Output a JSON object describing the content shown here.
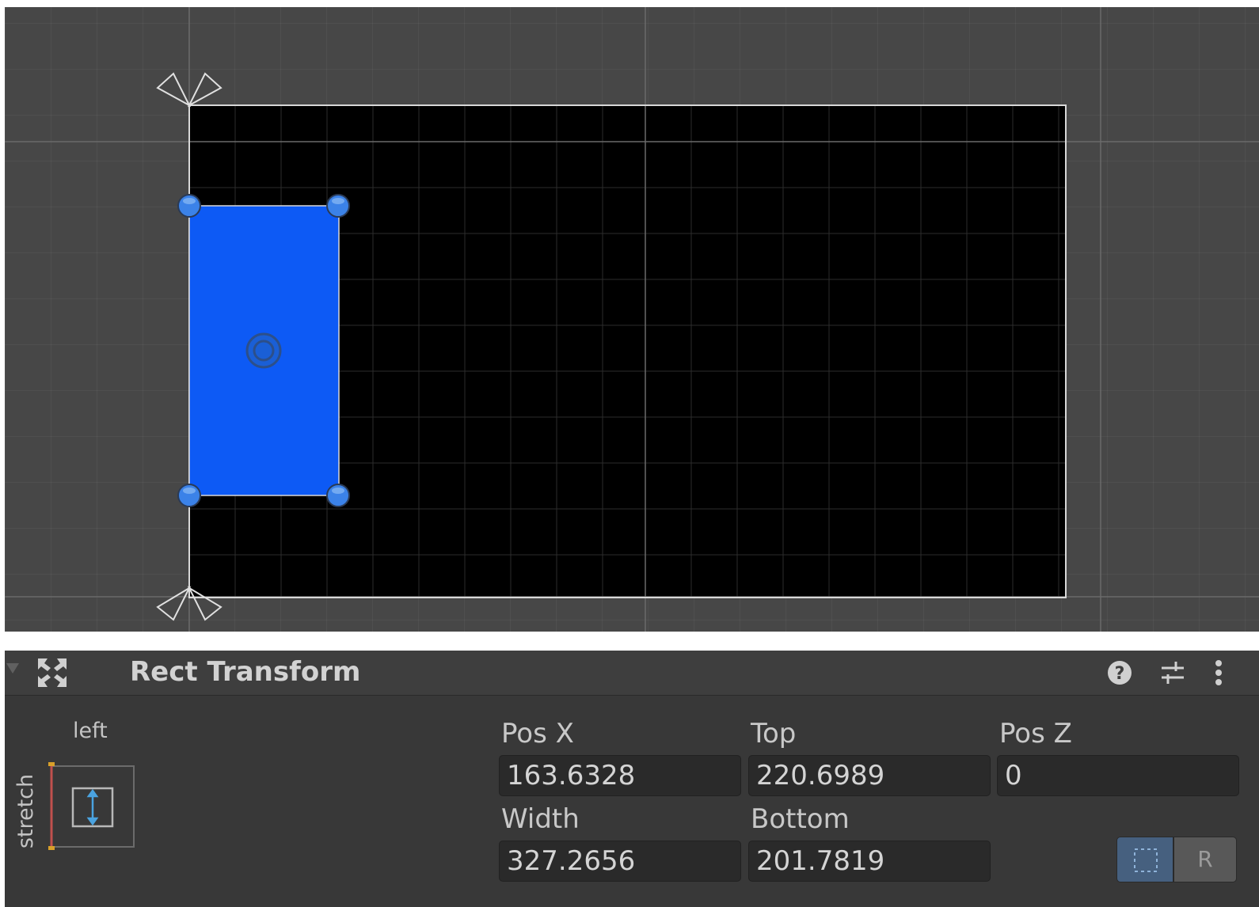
{
  "component": {
    "title": "Rect Transform",
    "icon": "rect-transform-icon",
    "header_icons": [
      "help-icon",
      "presets-icon",
      "kebab-menu-icon"
    ]
  },
  "anchor": {
    "horizontal_label": "left",
    "vertical_label": "stretch"
  },
  "fields": {
    "pos_x": {
      "label": "Pos X",
      "value": "163.6328"
    },
    "top": {
      "label": "Top",
      "value": "220.6989"
    },
    "pos_z": {
      "label": "Pos Z",
      "value": "0"
    },
    "width": {
      "label": "Width",
      "value": "327.2656"
    },
    "bottom": {
      "label": "Bottom",
      "value": "201.7819"
    }
  },
  "toggles": {
    "raw_label": "R"
  },
  "colors": {
    "scene_background": "#474747",
    "canvas_background": "#000000",
    "selected_rect": "#0d5af5",
    "handle": "#3b82e8",
    "inspector_background": "#383838",
    "blueprint_toggle_active": "#46607f"
  }
}
